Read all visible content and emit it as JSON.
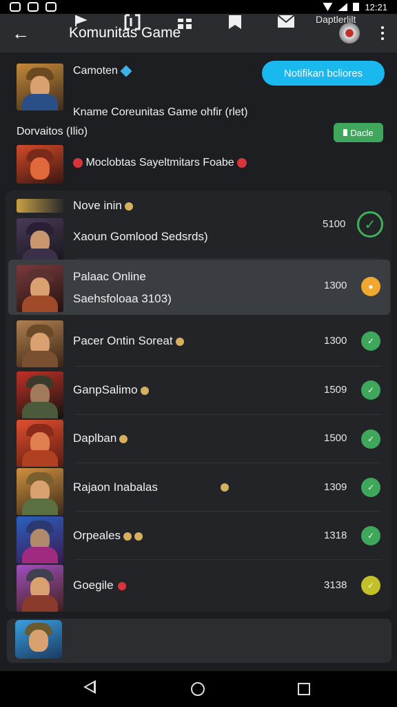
{
  "status_bar": {
    "time": "12:21"
  },
  "app_bar": {
    "title": "Komunitas Game"
  },
  "top_card": {
    "name": "Camoten",
    "notify_button": "Notifikan bcliores",
    "subtitle_line": "Kname Coreunitas Game ohfir (rlet)",
    "section_label": "Dorvaitos (Ilio)",
    "green_button": "Dacle",
    "feed_line": "Moclobtas Sayeltmitars Foabe"
  },
  "list": {
    "header_item": "Nove  inin",
    "items": [
      {
        "label": "Xaoun Gomlood Sedsrds)",
        "count": "5100",
        "status": "checked",
        "color": "#3fb35a"
      },
      {
        "label_line1": "Palaac Online",
        "label_line2": "Saehsfoloaa 3103)",
        "count": "1300",
        "status": "pending",
        "color": "#f0a830"
      },
      {
        "label": "Pacer Ontin Soreat",
        "count": "1300",
        "status": "ok",
        "color": "#3fa75b"
      },
      {
        "label": "GanpSalimo",
        "count": "1509",
        "status": "ok",
        "color": "#3fa75b"
      },
      {
        "label": "Daplban",
        "count": "1500",
        "status": "ok",
        "color": "#3fa75b"
      },
      {
        "label": "Rajaon Inabalas",
        "count": "1309",
        "status": "ok",
        "color": "#3fa75b"
      },
      {
        "label": "Orpeales",
        "count": "1318",
        "status": "ok",
        "color": "#3fa75b"
      },
      {
        "label": "Goegile",
        "count": "3138",
        "status": "ok",
        "color": "#c3c12a"
      }
    ]
  },
  "bottom_nav": {
    "label": "Daptlerlilt"
  },
  "icons": [
    "back-arrow-icon",
    "kebab-icon",
    "flag-icon",
    "frame-icon",
    "gift-icon",
    "bookmark-icon",
    "mail-icon",
    "check-icon"
  ],
  "accent": "#19b8ef"
}
